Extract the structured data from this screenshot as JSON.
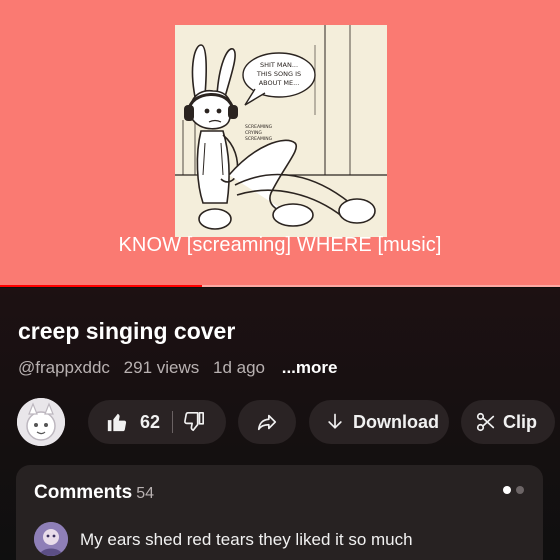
{
  "player": {
    "caption": "KNOW [screaming] WHERE [music]",
    "speech_bubble_lines": [
      "SHIT MAN...",
      "THIS SONG IS",
      "ABOUT ME..."
    ],
    "side_note_lines": [
      "SCREAMING",
      "CRYING",
      "SCREAMING"
    ],
    "progress": 0.36,
    "background_color": "#fa7a72",
    "progress_color": "#ff0000"
  },
  "video": {
    "title": "creep singing cover",
    "channel": "@frappxddc",
    "views": "291 views",
    "age": "1d ago",
    "more_label": "...more"
  },
  "actions": {
    "channel_avatar_icon": "avatar-icon",
    "like_icon": "thumbs-up-icon",
    "like_count": "62",
    "dislike_icon": "thumbs-down-icon",
    "share_icon": "share-arrow-icon",
    "download_icon": "download-arrow-icon",
    "download_label": "Download",
    "clip_icon": "scissors-icon",
    "clip_label": "Clip"
  },
  "comments": {
    "heading": "Comments",
    "count": "54",
    "top_comment": "My ears shed red tears they liked it so much"
  }
}
